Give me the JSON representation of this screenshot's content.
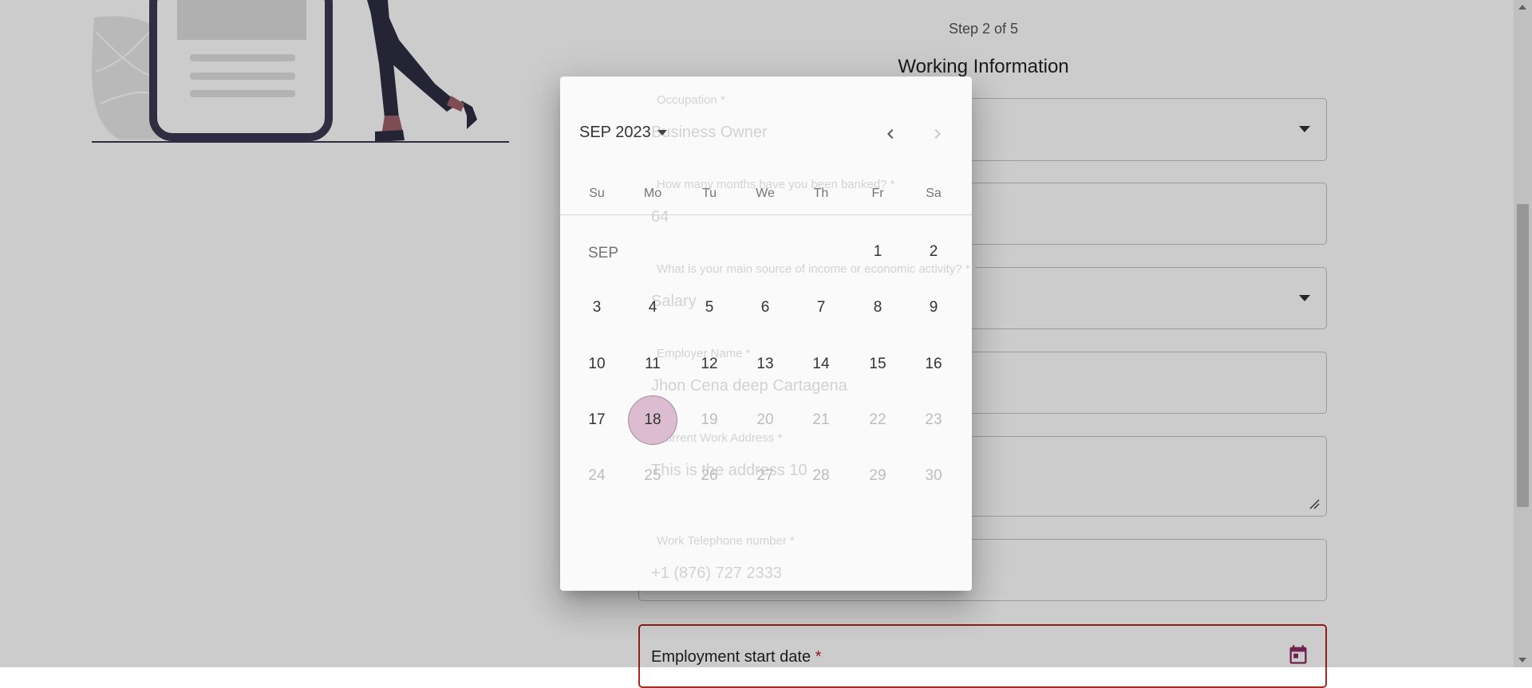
{
  "form": {
    "step": "Step 2 of 5",
    "title": "Working Information",
    "fields": [
      {
        "label": "Occupation *",
        "value": "Business Owner",
        "type": "select"
      },
      {
        "label": "How many months have you been banked? *",
        "value": "64",
        "type": "text"
      },
      {
        "label": "What is your main source of income or economic activity? *",
        "value": "Salary",
        "type": "select"
      },
      {
        "label": "Employer Name *",
        "value": "Jhon Cena deep Cartagena",
        "type": "text"
      },
      {
        "label": "Current Work Address *",
        "value": "This is the address 10",
        "type": "textarea"
      },
      {
        "label": "Work Telephone number *",
        "value": "+1 (876) 727 2333",
        "type": "text"
      }
    ],
    "start_date": {
      "label": "Employment start date",
      "required_mark": "*"
    }
  },
  "datepicker": {
    "month_label": "SEP 2023",
    "month_tag": "SEP",
    "weekdays": [
      "Su",
      "Mo",
      "Tu",
      "We",
      "Th",
      "Fr",
      "Sa"
    ],
    "first_weekday_index": 5,
    "days_in_month": 30,
    "selected_day": 18,
    "max_enabled_day": 18,
    "next_enabled": false
  },
  "colors": {
    "accent": "#8e2a63",
    "selected_fill": "#dcbcd0",
    "error_border": "#b3261e"
  },
  "icons": [
    "chevron-left-icon",
    "chevron-right-icon",
    "calendar-icon",
    "dropdown-caret-icon"
  ]
}
